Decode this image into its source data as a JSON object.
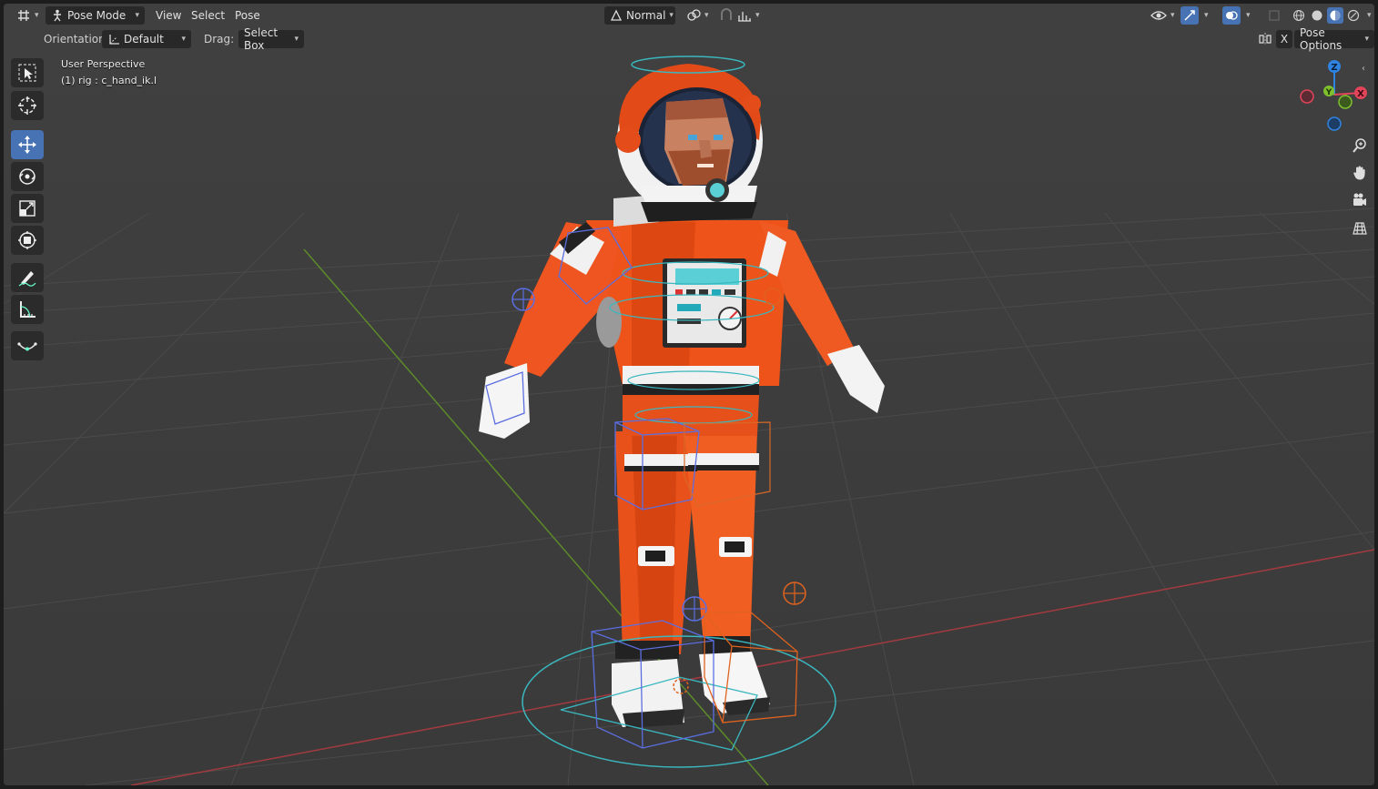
{
  "header": {
    "editor_type_icon": "editor-type-icon",
    "mode": {
      "label": "Pose Mode",
      "icon": "pose-mode-icon"
    },
    "menus": [
      "View",
      "Select",
      "Pose"
    ],
    "transform_orientation": "Normal",
    "pivot_icon": "pivot-icon",
    "snap_icon": "snap-icon",
    "proportional_icon": "proportional-edit-icon",
    "visibility_icon": "visibility-eye-icon",
    "gizmo_icon": "gizmo-icon",
    "overlay_icon": "overlay-icon",
    "xray_icon": "xray-icon",
    "shading_modes": [
      "wireframe",
      "solid",
      "material",
      "rendered"
    ],
    "active_shading": "material"
  },
  "tool_header": {
    "orientation_label": "Orientation:",
    "orientation_value": "Default",
    "drag_label": "Drag:",
    "drag_value": "Select Box",
    "x_mirror": "X",
    "pose_options": "Pose Options"
  },
  "toolbar": {
    "tools": [
      "select-box",
      "cursor",
      "move",
      "rotate",
      "scale",
      "transform",
      "annotate",
      "measure",
      "bone-curve"
    ],
    "active_tool": "move"
  },
  "viewport": {
    "perspective_label": "User Perspective",
    "active_object": "(1) rig : c_hand_ik.l"
  },
  "gizmo": {
    "axes": [
      "Z",
      "Y",
      "X"
    ],
    "colors": {
      "x": "#e2445a",
      "y": "#7fc02f",
      "z": "#2f84e2"
    }
  },
  "nav_buttons": [
    "zoom-icon",
    "hand-pan-icon",
    "camera-icon",
    "grid-ortho-icon"
  ],
  "colors": {
    "accent": "#4772b3",
    "background": "#3d3d3d",
    "suit_orange": "#e84a12",
    "rig_blue": "#5b6ee0",
    "rig_cyan": "#3ab7bf",
    "rig_orange": "#e0631f"
  }
}
